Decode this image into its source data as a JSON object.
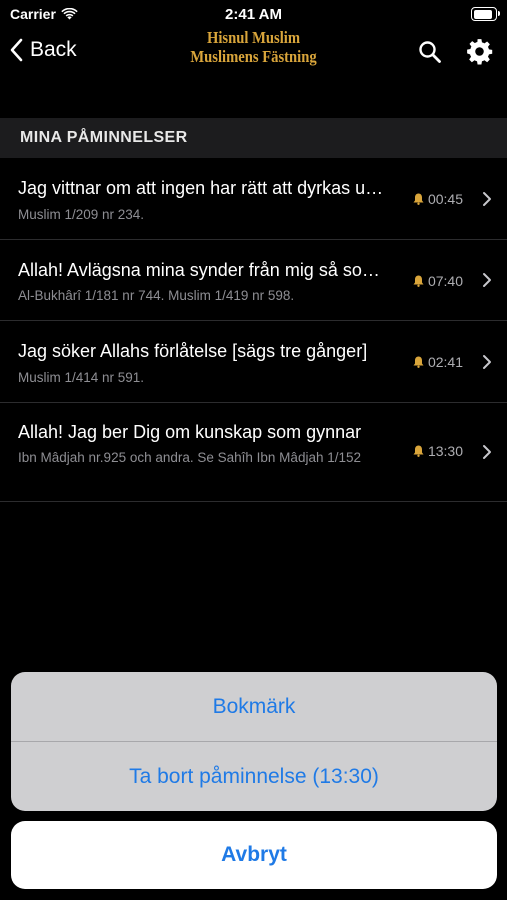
{
  "status_bar": {
    "carrier": "Carrier",
    "time": "2:41 AM",
    "battery_level": 1.0
  },
  "nav": {
    "back_label": "Back",
    "title_line1": "Hisnul Muslim",
    "title_line2": "Muslimens Fästning",
    "icons": [
      "chevron-left-icon",
      "search-icon",
      "gear-icon"
    ]
  },
  "section": {
    "header": "MINA PÅMINNELSER"
  },
  "reminders": [
    {
      "title": "Jag vittnar om att ingen har rätt att dyrkas utom Allah",
      "source": "Muslim 1/209 nr 234.",
      "time": "00:45"
    },
    {
      "title": "Allah! Avlägsna mina synder från mig så som Du",
      "source": "Al-Bukhârî 1/181 nr 744. Muslim 1/419 nr 598.",
      "time": "07:40"
    },
    {
      "title": "Jag söker Allahs förlåtelse [sägs tre gånger]",
      "source": "Muslim 1/414 nr 591.",
      "time": "02:41"
    },
    {
      "title": "Allah! Jag ber Dig om kunskap som gynnar",
      "source": "Ibn Mâdjah nr.925 och andra. Se Sahîh Ibn Mâdjah 1/152",
      "time": "13:30"
    }
  ],
  "action_sheet": {
    "bookmark": "Bokmärk",
    "remove_reminder": "Ta bort påminnelse (13:30)",
    "cancel": "Avbryt"
  },
  "colors": {
    "accent": "#1f7ae6",
    "bell": "#d9a53b",
    "title_gold": "#d9a53b"
  }
}
